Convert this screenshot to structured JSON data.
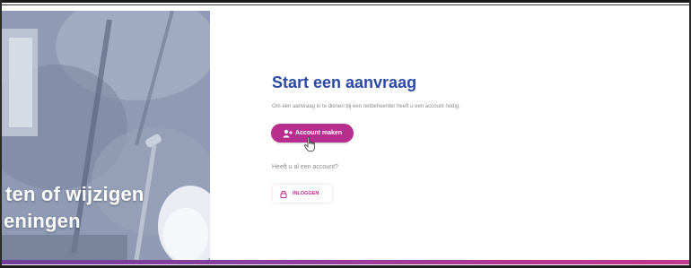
{
  "hero": {
    "line1": "ten of wijzigen",
    "line2": "eningen"
  },
  "main": {
    "title": "Start een aanvraag",
    "description": "Om een aanvraag in te dienen bij een netbeheerder heeft u een account nodig.",
    "create_account_label": "Account maken",
    "has_account_text": "Heeft u al een account?",
    "login_label": "INLOGGEN"
  },
  "colors": {
    "brand_blue": "#2c4aa3",
    "brand_magenta": "#b82e8f",
    "hero_overlay": "#8d99b3"
  },
  "icons": {
    "create_account": "user-plus-icon",
    "login": "lock-icon",
    "cursor": "hand-pointer-icon"
  }
}
